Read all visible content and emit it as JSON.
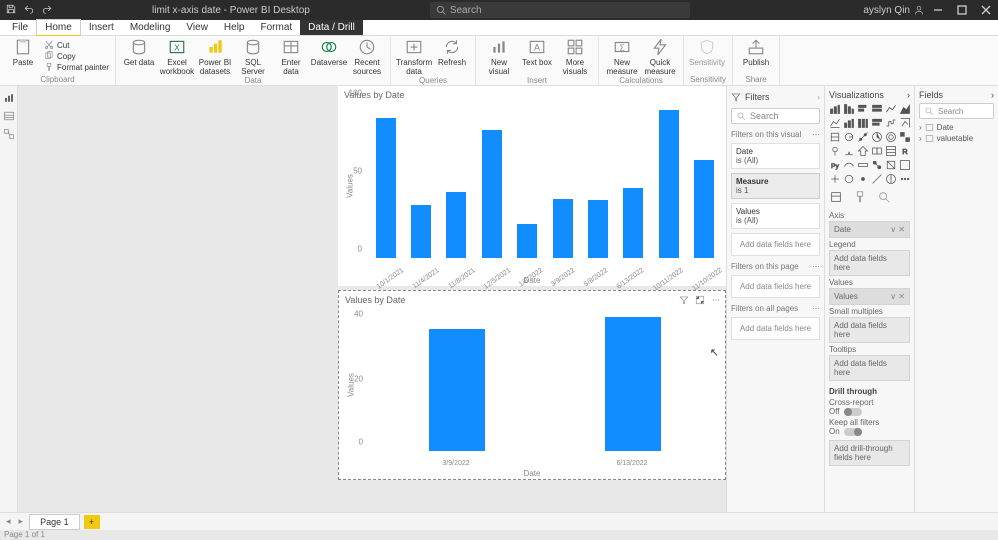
{
  "title_bar": {
    "doc_title": "limit x-axis date - Power BI Desktop",
    "search_placeholder": "Search",
    "user_name": "ayslyn Qin"
  },
  "menu": {
    "items": [
      "File",
      "Home",
      "Insert",
      "Modeling",
      "View",
      "Help",
      "Format",
      "Data / Drill"
    ],
    "active": "Home"
  },
  "ribbon": {
    "clipboard": {
      "cut": "Cut",
      "copy": "Copy",
      "painter": "Format painter",
      "paste": "Paste",
      "group": "Clipboard"
    },
    "data": {
      "get": "Get data",
      "excel": "Excel workbook",
      "pbi": "Power BI datasets",
      "sql": "SQL Server",
      "enter": "Enter data",
      "dv": "Dataverse",
      "recent": "Recent sources",
      "group": "Data"
    },
    "queries": {
      "transform": "Transform data",
      "refresh": "Refresh",
      "group": "Queries"
    },
    "insert": {
      "newvisual": "New visual",
      "textbox": "Text box",
      "morevisuals": "More visuals",
      "group": "Insert"
    },
    "calc": {
      "newmeasure": "New measure",
      "quickmeasure": "Quick measure",
      "group": "Calculations"
    },
    "sens": {
      "sens": "Sensitivity",
      "group": "Sensitivity"
    },
    "share": {
      "publish": "Publish",
      "group": "Share"
    }
  },
  "chart_data": [
    {
      "type": "bar",
      "title": "Values by Date",
      "xlabel": "Date",
      "ylabel": "Values",
      "ylim": [
        0,
        100
      ],
      "yticks": [
        0,
        50,
        100
      ],
      "categories": [
        "10/1/2021",
        "11/4/2021",
        "11/8/2021",
        "12/5/2021",
        "1/8/2022",
        "3/9/2022",
        "5/8/2022",
        "6/13/2022",
        "10/11/2022",
        "11/10/2022"
      ],
      "values": [
        90,
        34,
        42,
        82,
        22,
        38,
        37,
        45,
        95,
        63
      ]
    },
    {
      "type": "bar",
      "title": "Values by Date",
      "xlabel": "Date",
      "ylabel": "Values",
      "ylim": [
        0,
        45
      ],
      "yticks": [
        0,
        20,
        40
      ],
      "categories": [
        "3/9/2022",
        "6/13/2022"
      ],
      "values": [
        38,
        42
      ]
    }
  ],
  "filters": {
    "header": "Filters",
    "search_placeholder": "Search",
    "on_visual": "Filters on this visual",
    "cards": [
      {
        "name": "Date",
        "state": "is (All)"
      },
      {
        "name": "Measure",
        "state": "is 1",
        "on": true
      },
      {
        "name": "Values",
        "state": "is (All)"
      }
    ],
    "add_here": "Add data fields here",
    "on_page": "Filters on this page",
    "on_all": "Filters on all pages"
  },
  "viz": {
    "header": "Visualizations",
    "sections": {
      "axis": "Axis",
      "legend": "Legend",
      "values_lbl": "Values",
      "small": "Small multiples",
      "tooltips": "Tooltips",
      "drill": "Drill through",
      "cross": "Cross-report",
      "keep": "Keep all filters",
      "adddrill": "Add drill-through fields here"
    },
    "wells": {
      "axis_val": "Date",
      "values_val": "Values",
      "empty": "Add data fields here"
    },
    "toggles": {
      "off": "Off",
      "on": "On"
    }
  },
  "fields": {
    "header": "Fields",
    "search_placeholder": "Search",
    "tables": [
      {
        "name": "Date"
      },
      {
        "name": "valuetable"
      }
    ]
  },
  "pages": {
    "page1": "Page 1",
    "status": "Page 1 of 1"
  }
}
